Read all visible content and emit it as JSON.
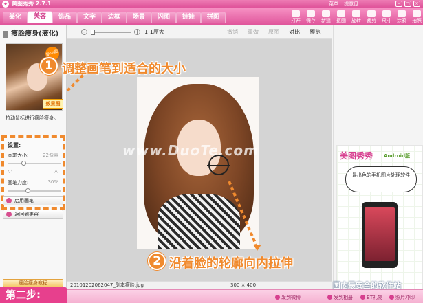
{
  "titlebar": {
    "app_title": "美图秀秀 2.7.1",
    "links": [
      "菜单",
      "提意见"
    ]
  },
  "menubar": {
    "tabs": [
      "美化",
      "美容",
      "饰品",
      "文字",
      "边框",
      "场景",
      "闪图",
      "娃娃",
      "拼图"
    ],
    "active_tab": "美容",
    "tools": [
      "打开",
      "保存",
      "新建",
      "抠图",
      "旋转",
      "裁剪",
      "尺寸",
      "涂鸦",
      "拍照"
    ]
  },
  "left_panel": {
    "title": "瘦脸瘦身(液化)",
    "thumb_badge": "效果图",
    "thumb_sticker": "新功能",
    "hint": "拉动鼠标进行瘦脸瘦身。",
    "settings": {
      "heading": "设置:",
      "brush_size_label": "画笔大小:",
      "brush_size_value": "22像素",
      "brush_size_min": "小",
      "brush_size_max": "大",
      "brush_strength_label": "画笔力度:",
      "brush_strength_value": "30%",
      "brush_strength_min": "小",
      "brush_strength_max": "大"
    },
    "buttons": {
      "enable_brush": "启用画笔",
      "back_to_beauty": "返回到美容",
      "bottom": "瘦脸瘦身教程"
    }
  },
  "canvas_toolbar": {
    "zoom_label": "1:1原大",
    "undo": "撤销",
    "redo": "重做",
    "reset": "原图",
    "compare": "对比",
    "preview": "预览"
  },
  "canvas": {
    "watermark": "www.DuoTe.com"
  },
  "canvas_status": {
    "filename": "20101202062047_副本瘦脸.jpg",
    "dimensions": "300 × 400"
  },
  "right_ad": {
    "title": "美图秀秀",
    "android": "Android版",
    "bubble": "最出色的手机图片处理软件"
  },
  "bottom_bar": {
    "items": [
      "发到微博",
      "发到相册",
      "BT礼物",
      "照片冲印"
    ]
  },
  "overlay": {
    "step1_number": "1",
    "step1_text": "调整画笔到适合的大小",
    "step2_number": "2",
    "step2_text": "沿着脸的轮廓向内拉伸",
    "second_step": "第二步:",
    "site_watermark": "国内最安全的软件站"
  },
  "colors": {
    "brand_pink": "#e2509b",
    "annotation_orange": "#f08a2e"
  }
}
